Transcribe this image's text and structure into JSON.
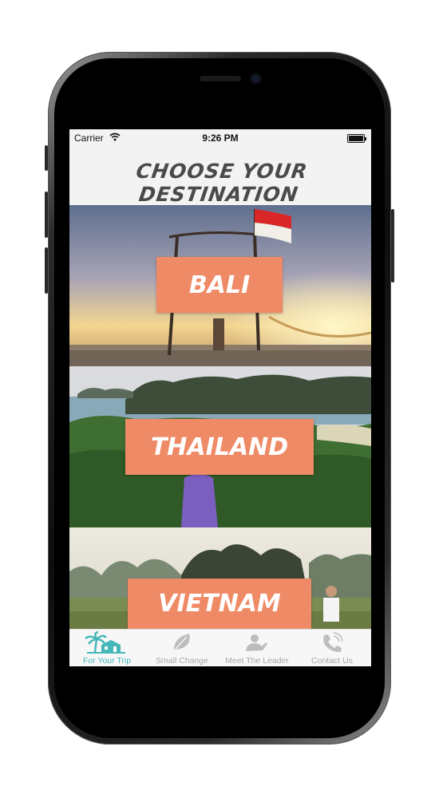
{
  "status_bar": {
    "carrier": "Carrier",
    "time": "9:26 PM"
  },
  "header": {
    "title": "CHOOSE YOUR DESTINATION"
  },
  "destinations": [
    {
      "label": "BALI"
    },
    {
      "label": "THAILAND"
    },
    {
      "label": "VIETNAM"
    }
  ],
  "tabs": [
    {
      "label": "For Your Trip",
      "icon": "palm-house-icon",
      "active": true
    },
    {
      "label": "Small Change",
      "icon": "leaf-icon",
      "active": false
    },
    {
      "label": "Meet The Leader",
      "icon": "person-icon",
      "active": false
    },
    {
      "label": "Contact Us",
      "icon": "phone-icon",
      "active": false
    }
  ],
  "colors": {
    "accent": "#ef8a66",
    "tab_active": "#45b7b8",
    "tab_inactive": "#a9a9a9",
    "title": "#4a4a4a"
  }
}
